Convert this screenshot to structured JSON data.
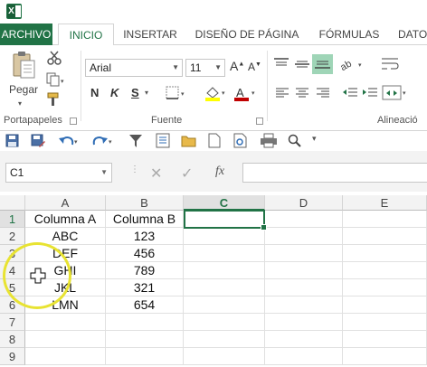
{
  "app_icon": "excel-logo",
  "ribbon": {
    "tabs": [
      {
        "label": "ARCHIVO"
      },
      {
        "label": "INICIO"
      },
      {
        "label": "INSERTAR"
      },
      {
        "label": "DISEÑO DE PÁGINA"
      },
      {
        "label": "FÓRMULAS"
      },
      {
        "label": "DATO"
      }
    ],
    "paste_label": "Pegar",
    "font_name": "Arial",
    "font_size": "11",
    "bold": "N",
    "italic": "K",
    "underline": "S",
    "groups": {
      "clipboard": "Portapapeles",
      "font": "Fuente",
      "alignment": "Alineació"
    }
  },
  "formula_bar": {
    "name_box": "C1",
    "fx": "fx",
    "formula": ""
  },
  "grid": {
    "columns": [
      "A",
      "B",
      "C",
      "D",
      "E"
    ],
    "selected_column": "C",
    "rows": [
      "1",
      "2",
      "3",
      "4",
      "5",
      "6",
      "7",
      "8",
      "9"
    ],
    "selected_row": "1",
    "cells": [
      [
        "Columna A",
        "Columna B"
      ],
      [
        "ABC",
        "123"
      ],
      [
        "DEF",
        "456"
      ],
      [
        "GHI",
        "789"
      ],
      [
        "JKL",
        "321"
      ],
      [
        "LMN",
        "654"
      ]
    ]
  },
  "colors": {
    "excel_green": "#217346",
    "highlight": "#e8e332"
  }
}
